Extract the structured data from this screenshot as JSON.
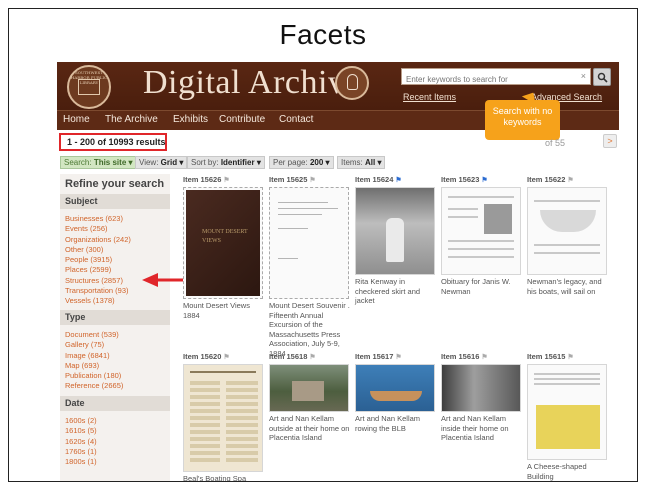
{
  "slide": {
    "title": "Facets"
  },
  "header": {
    "brand_title": "Digital Archive",
    "seal_text": "SOUTHWEST HARBOR PUBLIC LIBRARY",
    "search_placeholder": "Enter keywords to search for",
    "clear_glyph": "×",
    "recent_items": "Recent Items",
    "advanced_search": "Advanced Search"
  },
  "nav": [
    "Home",
    "The Archive",
    "Exhibits",
    "Contribute",
    "Contact"
  ],
  "tooltip": {
    "text": "Search with no keywords"
  },
  "results": {
    "count_text": "1 - 200 of 10993 results",
    "pager_text": "of 55",
    "next_glyph": ">"
  },
  "filters": {
    "search_label": "Search:",
    "search_value": "This site ▾",
    "view_label": "View:",
    "view_value": "Grid ▾",
    "sort_label": "Sort by:",
    "sort_value": "Identifier ▾",
    "perpage_label": "Per page:",
    "perpage_value": "200 ▾",
    "items_label": "Items:",
    "items_value": "All ▾"
  },
  "sidebar": {
    "heading": "Refine your search",
    "facets": [
      {
        "title": "Subject",
        "items": [
          "Businesses (623)",
          "Events (256)",
          "Organizations (242)",
          "Other (300)",
          "People (3915)",
          "Places (2599)",
          "Structures (2857)",
          "Transportation (93)",
          "Vessels (1378)"
        ]
      },
      {
        "title": "Type",
        "items": [
          "Document (539)",
          "Gallery (75)",
          "Image (6841)",
          "Map (693)",
          "Publication (180)",
          "Reference (2665)"
        ]
      },
      {
        "title": "Date",
        "items": [
          "1600s (2)",
          "1610s (5)",
          "1620s (4)",
          "1760s (1)",
          "1800s (1)"
        ]
      }
    ]
  },
  "grid": {
    "row1": [
      {
        "title": "Item 15626",
        "flag": "off",
        "caption": "Mount Desert Views 1884",
        "thumb": "book",
        "book_text": "MOUNT DESERT VIEWS"
      },
      {
        "title": "Item 15625",
        "flag": "off",
        "caption": "Mount Desert Souvenir . Fifteenth Annual Excursion of the Massachusetts Press Association, July 5-9, 1884",
        "thumb": "doc"
      },
      {
        "title": "Item 15624",
        "flag": "on",
        "caption": "Rita Kenway in checkered skirt and jacket",
        "thumb": "photo-bw"
      },
      {
        "title": "Item 15623",
        "flag": "on",
        "caption": "Obituary for Janis W. Newman",
        "thumb": "obit"
      },
      {
        "title": "Item 15622",
        "flag": "off",
        "caption": "Newman's legacy, and his boats, will sail on",
        "thumb": "article"
      }
    ],
    "row2": [
      {
        "title": "Item 15620",
        "flag": "off",
        "caption": "Beal's Boating Spa",
        "thumb": "newspaper"
      },
      {
        "title": "Item 15618",
        "flag": "off",
        "caption": "Art and Nan Kellam outside at their home on Placentia Island",
        "thumb": "house"
      },
      {
        "title": "Item 15617",
        "flag": "off",
        "caption": "Art and Nan Kellam rowing the BLB",
        "thumb": "boat"
      },
      {
        "title": "Item 15616",
        "flag": "off",
        "caption": "Art and Nan Kellam inside their home on Placentia Island",
        "thumb": "interior"
      },
      {
        "title": "Item 15615",
        "flag": "off",
        "caption": "A Cheese-shaped Building",
        "thumb": "cheese"
      }
    ]
  },
  "colors": {
    "banner": "#4a1e0d",
    "accent_orange": "#f6a21b",
    "facet_link": "#d1642a",
    "highlight_red": "#e0262a"
  }
}
